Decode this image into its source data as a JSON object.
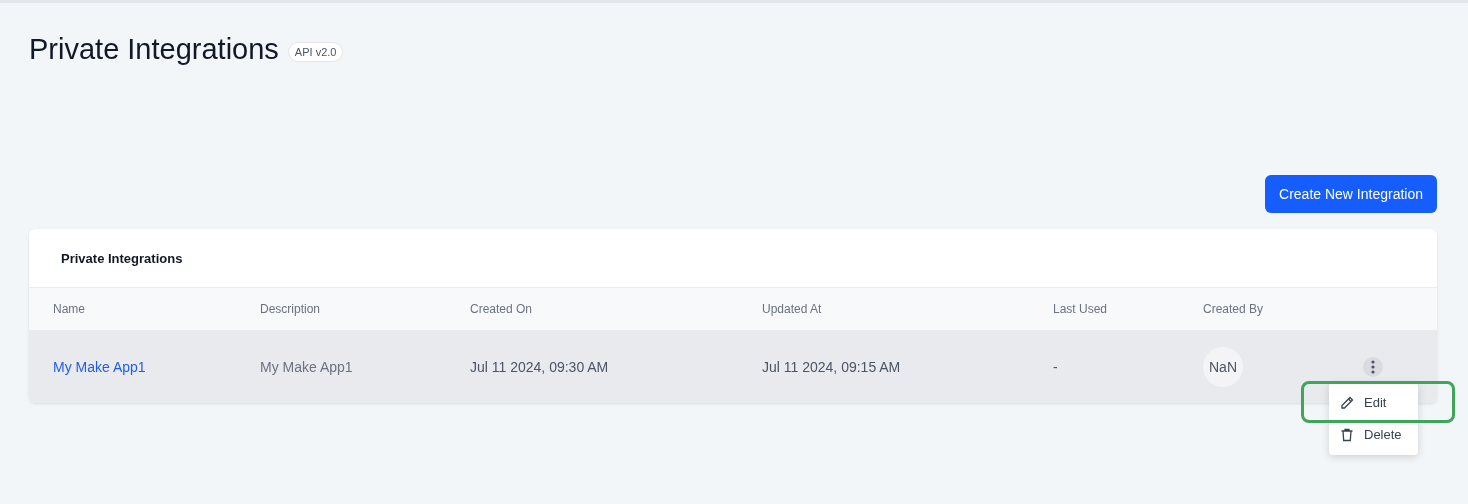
{
  "page": {
    "title": "Private Integrations",
    "badge": "API v2.0"
  },
  "create_button": "Create New Integration",
  "table": {
    "title": "Private Integrations",
    "columns": [
      "Name",
      "Description",
      "Created On",
      "Updated At",
      "Last Used",
      "Created By"
    ],
    "rows": [
      {
        "name": "My Make App1",
        "description": "My Make App1",
        "created_on": "Jul 11 2024, 09:30 AM",
        "updated_at": "Jul 11 2024, 09:15 AM",
        "last_used": "-",
        "created_by": "NaN",
        "selected": true,
        "menu_open": true
      }
    ]
  },
  "row_menu": [
    {
      "kind": "edit",
      "label": "Edit",
      "highlighted": true
    },
    {
      "kind": "delete",
      "label": "Delete",
      "highlighted": false
    }
  ]
}
